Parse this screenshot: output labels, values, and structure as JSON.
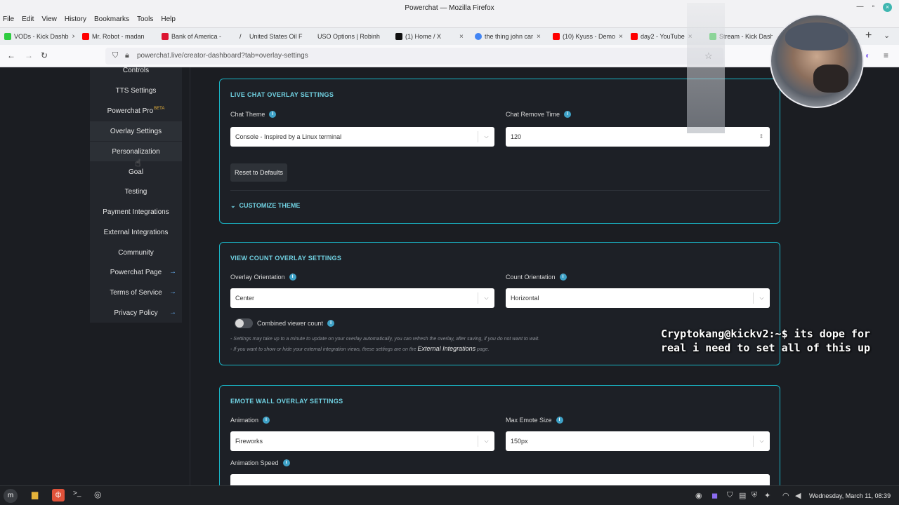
{
  "window": {
    "title": "Powerchat — Mozilla Firefox",
    "menu": [
      "File",
      "Edit",
      "View",
      "History",
      "Bookmarks",
      "Tools",
      "Help"
    ]
  },
  "tabs": [
    {
      "label": "VODs - Kick Dashb",
      "color": "#2ecc40"
    },
    {
      "label": "Mr. Robot - madan",
      "color": "#ff0000"
    },
    {
      "label": "Bank of America -",
      "color": "#dc1431"
    },
    {
      "label": "United States Oil F",
      "color": "#222222"
    },
    {
      "label": "USO Options | Robinh",
      "color": "#f2f2f2"
    },
    {
      "label": "(1) Home / X",
      "color": "#111111"
    },
    {
      "label": "the thing john car",
      "color": "#4285f4"
    },
    {
      "label": "(10) Kyuss - Demo",
      "color": "#ff0000"
    },
    {
      "label": "day2 - YouTube",
      "color": "#ff0000"
    },
    {
      "label": "Stream - Kick Dash",
      "color": "#2ecc40"
    }
  ],
  "url": "powerchat.live/creator-dashboard?tab=overlay-settings",
  "sidebar": {
    "items": [
      {
        "label": "Controls"
      },
      {
        "label": "TTS Settings"
      },
      {
        "label": "Powerchat Pro",
        "badge": "BETA"
      },
      {
        "label": "Overlay Settings"
      },
      {
        "label": "Personalization"
      },
      {
        "label": "Goal"
      },
      {
        "label": "Testing"
      },
      {
        "label": "Payment Integrations"
      },
      {
        "label": "External Integrations"
      },
      {
        "label": "Community"
      },
      {
        "label": "Powerchat Page"
      },
      {
        "label": "Terms of Service"
      },
      {
        "label": "Privacy Policy"
      }
    ]
  },
  "live_chat": {
    "title": "LIVE CHAT OVERLAY SETTINGS",
    "theme_label": "Chat Theme",
    "theme_value": "Console - Inspired by a Linux terminal",
    "remove_label": "Chat Remove Time",
    "remove_value": "120",
    "reset_label": "Reset to Defaults",
    "customize_label": "CUSTOMIZE THEME"
  },
  "view_count": {
    "title": "VIEW COUNT OVERLAY SETTINGS",
    "overlay_orientation_label": "Overlay Orientation",
    "overlay_orientation_value": "Center",
    "count_orientation_label": "Count Orientation",
    "count_orientation_value": "Horizontal",
    "combined_label": "Combined viewer count",
    "note1": "- Settings may take up to a minute to update on your overlay automatically, you can refresh the overlay, after saving, if you do not want to wait.",
    "note2_pre": "- If you want to show or hide your external integration views, these settings are on the",
    "note2_link": "External Integrations",
    "note2_post": "page."
  },
  "emote_wall": {
    "title": "EMOTE WALL OVERLAY SETTINGS",
    "animation_label": "Animation",
    "animation_value": "Fireworks",
    "max_size_label": "Max Emote Size",
    "max_size_value": "150px",
    "speed_label": "Animation Speed"
  },
  "caption": "Cryptokang@kickv2:~$ its dope for real i need to set all of this up",
  "taskbar": {
    "clock": "Wednesday, March 11, 08:39"
  }
}
